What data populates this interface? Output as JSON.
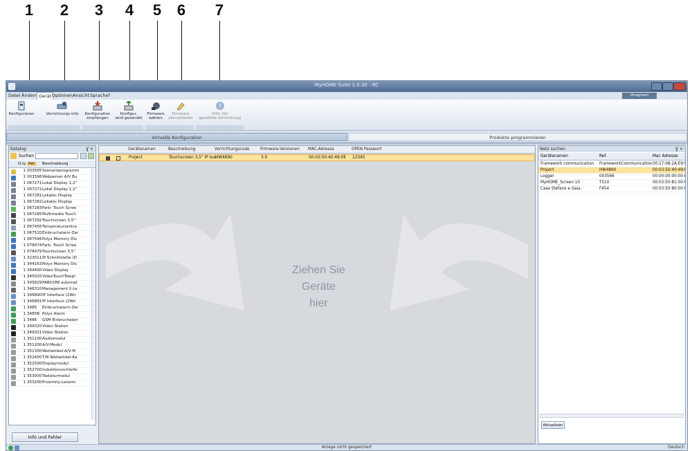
{
  "callouts": [
    "1",
    "2",
    "3",
    "4",
    "5",
    "6",
    "7"
  ],
  "window": {
    "title": "MyHOME Suite 1.0.30 - RC",
    "lang_badge": "Ufragment Messepunkt"
  },
  "menu": [
    "Datei",
    "Ändern",
    "Gerät",
    "Optionen",
    "Ansicht",
    "Sprache",
    "?"
  ],
  "ribbon": {
    "konfigurieren": "Konfigurieren",
    "vorrichtungs_info": "Vorrichtungs-Info",
    "konf_empfangen_1": "Konfiguration",
    "konf_empfangen_2": "empfangen",
    "konf_gesendet_1": "Konfigur.",
    "konf_gesendet_2": "wird gesendet",
    "firmware_waehlen_1": "Firmware",
    "firmware_waehlen_2": "wählen",
    "firmware_akt_1": "Firmware",
    "firmware_akt_2": "aktualisieren",
    "hilfe_1": "Hilfe (für",
    "hilfe_2": "gewählte Vorrichtung)"
  },
  "tabs": [
    "Virtuelle Konfiguration",
    "Produkte programmieren"
  ],
  "katalog": {
    "title": "Katalog",
    "controls": "Ɣ ×",
    "search_label": "Suchen",
    "headers": {
      "qty": "Q.ty",
      "ref": "Ref.",
      "desc": "Beschreibung"
    },
    "rows": [
      {
        "q": "1",
        "ref": "003565",
        "desc": "Szenarioprogramm",
        "color": "#e0c040"
      },
      {
        "q": "1",
        "ref": "003598",
        "desc": "Webserver A/V Bu",
        "color": "#3a78c8"
      },
      {
        "q": "1",
        "ref": "067271",
        "desc": "Lokal Display 1,2\"",
        "color": "#7a8290"
      },
      {
        "q": "1",
        "ref": "067272",
        "desc": "Lokal Display 1,2\"",
        "color": "#7a8290"
      },
      {
        "q": "1",
        "ref": "067281",
        "desc": "Lokales Display",
        "color": "#7a8290"
      },
      {
        "q": "1",
        "ref": "067282",
        "desc": "Lokales Display",
        "color": "#7a8290"
      },
      {
        "q": "1",
        "ref": "067283",
        "desc": "Farb- Touch Scree",
        "color": "#58b858"
      },
      {
        "q": "1",
        "ref": "067285",
        "desc": "Multimedia Touch",
        "color": "#444444"
      },
      {
        "q": "1",
        "ref": "067292",
        "desc": "Touchscreen 3,5\"",
        "color": "#555555"
      },
      {
        "q": "1",
        "ref": "067456",
        "desc": "Temperaturzentra",
        "color": "#8aa0c0"
      },
      {
        "q": "1",
        "ref": "067520",
        "desc": "Einbruchalarm-Zer",
        "color": "#3aa050"
      },
      {
        "q": "1",
        "ref": "067546",
        "desc": "Polyx Memory Dis",
        "color": "#3a78c8"
      },
      {
        "q": "1",
        "ref": "078474",
        "desc": "Farb- Touch Scree",
        "color": "#3a78c8"
      },
      {
        "q": "1",
        "ref": "078479",
        "desc": "Touchscreen 3,5\"",
        "color": "#555555"
      },
      {
        "q": "1",
        "ref": "323011",
        "desc": "IP-Schnittstelle (D",
        "color": "#6a90c8"
      },
      {
        "q": "1",
        "ref": "344163",
        "desc": "Polyx Memory Dis",
        "color": "#3a78c8"
      },
      {
        "q": "1",
        "ref": "344400",
        "desc": "Video Display",
        "color": "#3a78c8"
      },
      {
        "q": "1",
        "ref": "345020",
        "desc": "VideoTouchTelepl",
        "color": "#333333"
      },
      {
        "q": "1",
        "ref": "345829",
        "desc": "PABX288 automat",
        "color": "#888888"
      },
      {
        "q": "1",
        "ref": "346310",
        "desc": "Management 2-Le",
        "color": "#666666"
      },
      {
        "q": "1",
        "ref": "346890",
        "desc": "IP Interface (2Wir",
        "color": "#6a90c8"
      },
      {
        "q": "1",
        "ref": "346891",
        "desc": "IP Interface (2Wir",
        "color": "#6a90c8"
      },
      {
        "q": "1",
        "ref": "3485",
        "desc": "Einbruchalarm-Zer",
        "color": "#3aa050"
      },
      {
        "q": "1",
        "ref": "3485B",
        "desc": "Polyx Alarm",
        "color": "#3aa050"
      },
      {
        "q": "1",
        "ref": "3486",
        "desc": "GSM Einbruchalarr",
        "color": "#3aa050"
      },
      {
        "q": "1",
        "ref": "349320",
        "desc": "Video Station",
        "color": "#222222"
      },
      {
        "q": "1",
        "ref": "349321",
        "desc": "Video Station",
        "color": "#222222"
      },
      {
        "q": "1",
        "ref": "351100",
        "desc": "Audiomodul",
        "color": "#999999"
      },
      {
        "q": "1",
        "ref": "351200",
        "desc": "A/V-Modul",
        "color": "#999999"
      },
      {
        "q": "1",
        "ref": "351300",
        "desc": "Weitwinkel-A/V-M",
        "color": "#999999"
      },
      {
        "q": "1",
        "ref": "352400",
        "desc": "T/N Weitwinkel-Ka",
        "color": "#999999"
      },
      {
        "q": "1",
        "ref": "352500",
        "desc": "Displaymodul",
        "color": "#999999"
      },
      {
        "q": "1",
        "ref": "352700",
        "desc": "Induktionsschleife",
        "color": "#999999"
      },
      {
        "q": "1",
        "ref": "353000",
        "desc": "Tastaturmodul",
        "color": "#999999"
      },
      {
        "q": "1",
        "ref": "353200",
        "desc": "Proximity-Leserm",
        "color": "#999999"
      }
    ]
  },
  "devices": {
    "headers": [
      "Gerätenamen",
      "Beschreibung",
      "Vorrichtungscode",
      "Firmware-Versionen",
      "MAC-Adresse",
      "OPEN Passwort"
    ],
    "row": {
      "name": "Project",
      "desc": "Touchscreen 3,5\" IP bus",
      "code": "HW4890",
      "fw": "3.0",
      "mac": "00:03:50:40:49:0E",
      "pwd": "12345"
    },
    "drop_line1": "Ziehen Sie",
    "drop_line2": "Geräte",
    "drop_line3": "hier"
  },
  "netz": {
    "title": "Netz suchen",
    "controls": "Ɣ ×",
    "headers": [
      "Gerätenamen",
      "Ref.",
      "Mac Adresse"
    ],
    "rows": [
      {
        "name": "Framework communication",
        "ref": "FrameworkCommunication",
        "mac": "00:17:08:2A:E9:9"
      },
      {
        "name": "Project",
        "ref": "HW4890",
        "mac": "00:03:50:40:49:0"
      },
      {
        "name": "Logger",
        "ref": "003566",
        "mac": "00:00:00:00:00:0"
      },
      {
        "name": "MyHOME_Screen 10",
        "ref": "TS10",
        "mac": "00:03:50:81:00:C"
      },
      {
        "name": "Casa Stefano e Gaia",
        "ref": "F454",
        "mac": "00:03:50:80:00:0"
      }
    ],
    "refresh": "Aktualisier"
  },
  "info_button": "Info und Fehler",
  "status": {
    "text": "Anlage nicht gespeichert",
    "lang": "Deutsch"
  }
}
